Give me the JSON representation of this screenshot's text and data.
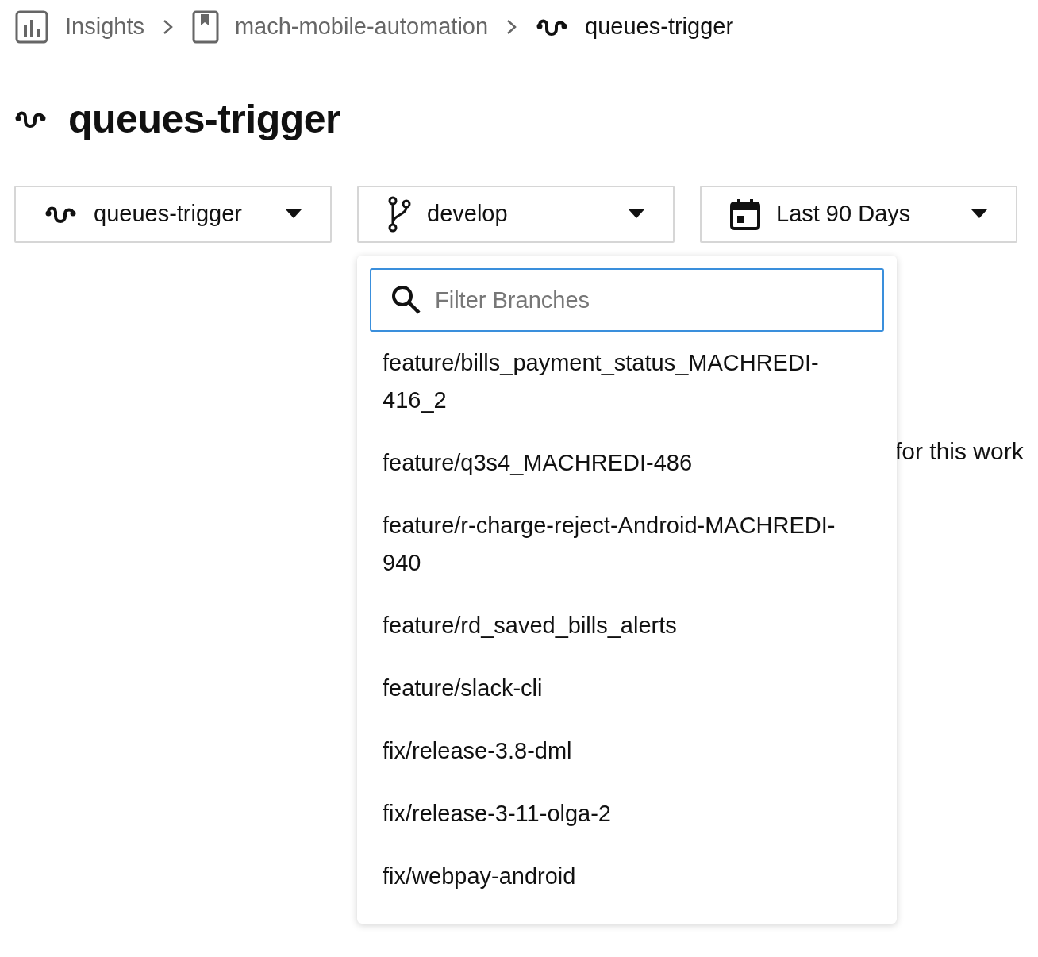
{
  "breadcrumb": [
    {
      "label": "Insights",
      "current": false
    },
    {
      "label": "mach-mobile-automation",
      "current": false
    },
    {
      "label": "queues-trigger",
      "current": true
    }
  ],
  "title": {
    "label": "queues-trigger"
  },
  "filters": [
    {
      "label": "queues-trigger"
    },
    {
      "label": "develop"
    },
    {
      "label": "Last 90 Days"
    }
  ],
  "branch_menu": {
    "search": {
      "placeholder": "Filter Branches"
    },
    "items": [
      "feature/bills_payment_status_MACHREDI-416_2",
      "feature/q3s4_MACHREDI-486",
      "feature/r-charge-reject-Android-MACHREDI-940",
      "feature/rd_saved_bills_alerts",
      "feature/slack-cli",
      "fix/release-3.8-dml",
      "fix/release-3-11-olga-2",
      "fix/webpay-android"
    ]
  },
  "background_text": "for this work"
}
